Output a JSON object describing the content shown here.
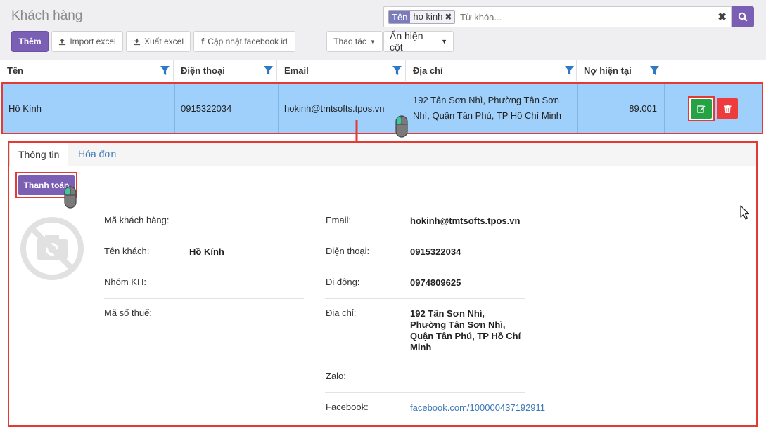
{
  "page": {
    "title": "Khách hàng"
  },
  "toolbar": {
    "add_label": "Thêm",
    "import_label": "Import excel",
    "export_label": "Xuất excel",
    "facebook_label": "Cập nhật facebook id",
    "actions_label": "Thao tác",
    "columns_label": "Ẩn hiện cột"
  },
  "search": {
    "tag_key": "Tên",
    "tag_value": "ho kinh",
    "placeholder": "Từ khóa..."
  },
  "table": {
    "columns": [
      "Tên",
      "Điện thoại",
      "Email",
      "Địa chỉ",
      "Nợ hiện tại"
    ],
    "row": {
      "name": "Hồ Kính",
      "phone": "0915322034",
      "email": "hokinh@tmtsofts.tpos.vn",
      "address": "192 Tân Sơn Nhì, Phường Tân Sơn Nhì, Quận Tân Phú, TP Hồ Chí Minh",
      "debt": "89.001"
    }
  },
  "detail": {
    "tabs": [
      "Thông tin",
      "Hóa đơn"
    ],
    "pay_label": "Thanh toán",
    "left": {
      "customer_code_label": "Mã khách hàng:",
      "customer_code": "",
      "name_label": "Tên khách:",
      "name": "Hồ Kính",
      "group_label": "Nhóm KH:",
      "group": "",
      "tax_label": "Mã số thuế:",
      "tax": ""
    },
    "right": {
      "email_label": "Email:",
      "email": "hokinh@tmtsofts.tpos.vn",
      "phone_label": "Điện thoại:",
      "phone": "0915322034",
      "mobile_label": "Di động:",
      "mobile": "0974809625",
      "address_label": "Địa chỉ:",
      "address": "192 Tân Sơn Nhì, Phường Tân Sơn Nhì, Quận Tân Phú, TP Hồ Chí Minh",
      "zalo_label": "Zalo:",
      "zalo": "",
      "facebook_label": "Facebook:",
      "facebook": "facebook.com/100000437192911"
    }
  },
  "colors": {
    "accent": "#7b5fb5",
    "highlight": "#e53935",
    "row_selected": "#9fd0fb",
    "edit": "#25a244",
    "delete": "#ef3b3b",
    "link": "#3b78b6"
  },
  "icons": {
    "search": "search-icon",
    "upload": "upload-icon",
    "download": "download-icon",
    "facebook": "facebook-icon",
    "filter": "filter-icon",
    "edit": "edit-icon",
    "trash": "trash-icon",
    "no_photo": "no-camera-icon",
    "mouse": "mouse-icon",
    "cursor": "cursor-icon",
    "arrow": "arrow-down-icon"
  }
}
